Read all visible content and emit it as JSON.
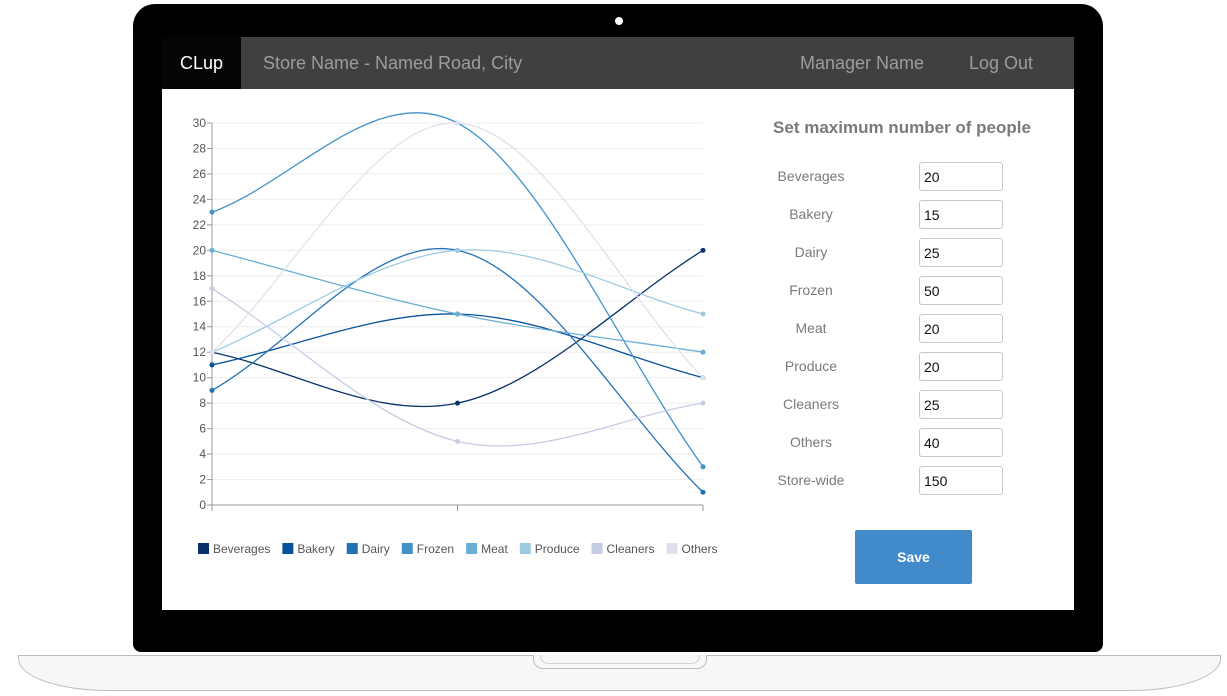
{
  "nav": {
    "brand": "CLup",
    "store_name": "Store Name - Named Road, City",
    "manager_name": "Manager Name",
    "logout": "Log Out"
  },
  "form": {
    "title": "Set maximum number of people",
    "rows": [
      {
        "label": "Beverages",
        "value": "20"
      },
      {
        "label": "Bakery",
        "value": "15"
      },
      {
        "label": "Dairy",
        "value": "25"
      },
      {
        "label": "Frozen",
        "value": "50"
      },
      {
        "label": "Meat",
        "value": "20"
      },
      {
        "label": "Produce",
        "value": "20"
      },
      {
        "label": "Cleaners",
        "value": "25"
      },
      {
        "label": "Others",
        "value": "40"
      },
      {
        "label": "Store-wide",
        "value": "150"
      }
    ],
    "save_label": "Save"
  },
  "colors": {
    "navbar": "#404040",
    "brand_bg": "#050505",
    "save_button": "#428bca"
  },
  "chart_data": {
    "type": "line",
    "ylim": [
      0,
      30
    ],
    "yticks": [
      0,
      2,
      4,
      6,
      8,
      10,
      12,
      14,
      16,
      18,
      20,
      22,
      24,
      26,
      28,
      30
    ],
    "grid": true,
    "legend_position": "bottom",
    "x": [
      0,
      1,
      2
    ],
    "series": [
      {
        "name": "Beverages",
        "color": "#08306b",
        "values": [
          12,
          8,
          20
        ]
      },
      {
        "name": "Bakery",
        "color": "#08519c",
        "values": [
          11,
          15,
          10
        ]
      },
      {
        "name": "Dairy",
        "color": "#2171b5",
        "values": [
          9,
          20,
          1
        ]
      },
      {
        "name": "Frozen",
        "color": "#4292c6",
        "values": [
          23,
          30,
          3
        ]
      },
      {
        "name": "Meat",
        "color": "#6baed6",
        "values": [
          20,
          15,
          12
        ]
      },
      {
        "name": "Produce",
        "color": "#9ecae1",
        "values": [
          12,
          20,
          15
        ]
      },
      {
        "name": "Cleaners",
        "color": "#c6cbe6",
        "values": [
          17,
          5,
          8
        ]
      },
      {
        "name": "Others",
        "color": "#e2e0f0",
        "values": [
          12,
          30,
          10
        ]
      }
    ]
  }
}
